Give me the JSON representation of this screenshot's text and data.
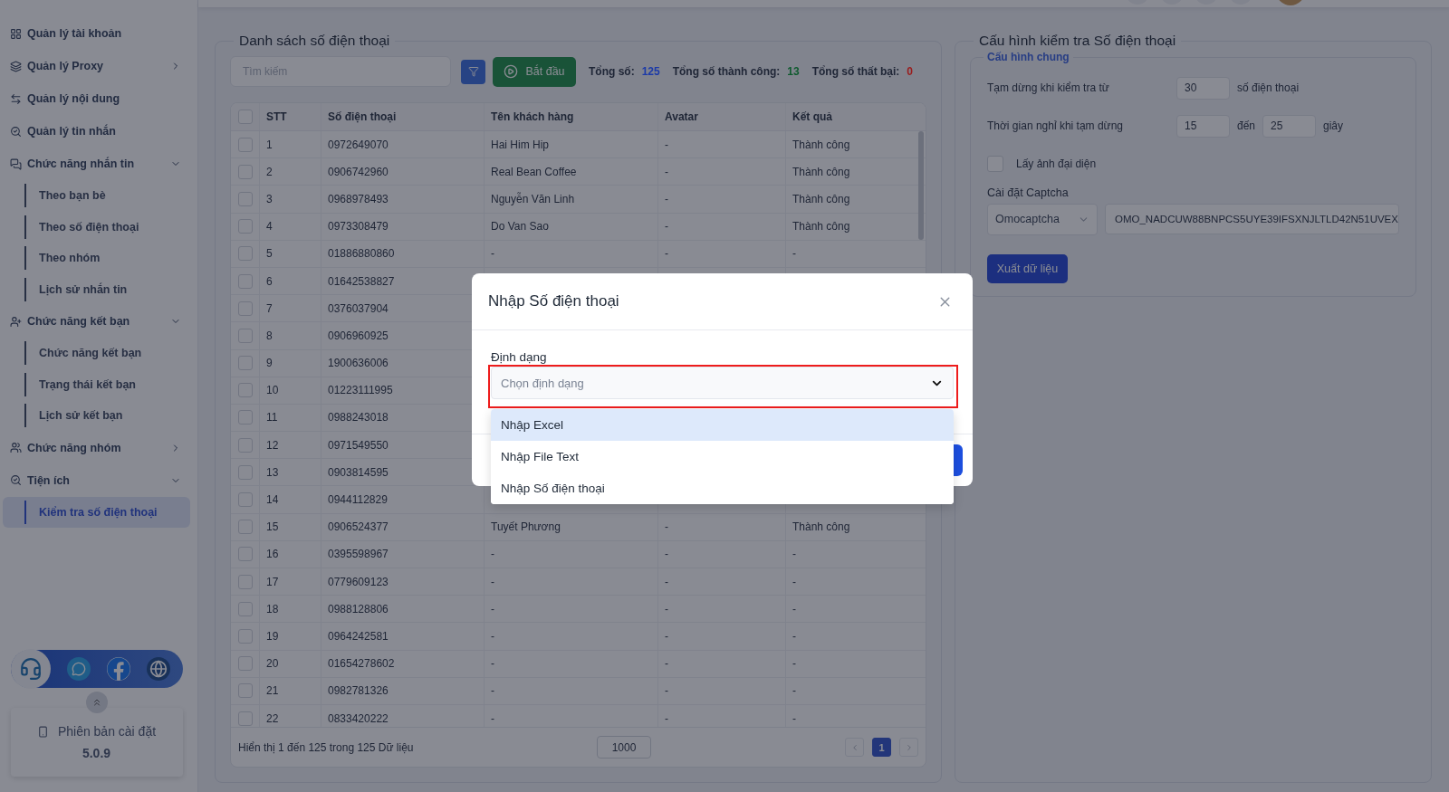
{
  "sidebar": {
    "items": [
      {
        "kind": "link",
        "label": "Quản lý tài khoản"
      },
      {
        "kind": "group",
        "label": "Quản lý Proxy",
        "expanded": false
      },
      {
        "kind": "link",
        "label": "Quản lý nội dung"
      },
      {
        "kind": "link",
        "label": "Quản lý tin nhắn"
      },
      {
        "kind": "group",
        "label": "Chức năng nhắn tin",
        "expanded": true,
        "children": [
          {
            "label": "Theo bạn bè",
            "selected": false
          },
          {
            "label": "Theo số điện thoại",
            "selected": false
          },
          {
            "label": "Theo nhóm",
            "selected": false
          },
          {
            "label": "Lịch sử nhắn tin",
            "selected": false
          }
        ]
      },
      {
        "kind": "group",
        "label": "Chức năng kết bạn",
        "expanded": true,
        "children": [
          {
            "label": "Chức năng kết bạn",
            "selected": false
          },
          {
            "label": "Trạng thái kết bạn",
            "selected": false
          },
          {
            "label": "Lịch sử kết bạn",
            "selected": false
          }
        ]
      },
      {
        "kind": "group",
        "label": "Chức năng nhóm",
        "expanded": false
      },
      {
        "kind": "group",
        "label": "Tiện ích",
        "expanded": true,
        "children": [
          {
            "label": "Kiểm tra số điện thoại",
            "selected": true
          }
        ]
      }
    ],
    "version": {
      "label": "Phiên bản cài đặt",
      "value": "5.0.9"
    }
  },
  "phone_list": {
    "title": "Danh sách số điện thoại",
    "search": {
      "placeholder": "Tìm kiếm"
    },
    "start_button": "Bắt đầu",
    "stats": [
      {
        "label": "Tổng số:",
        "value": "125",
        "color": "#1c3aa8"
      },
      {
        "label": "Tổng số thành công:",
        "value": "13",
        "color": "#0e5a2e"
      },
      {
        "label": "Tổng số thất bại:",
        "value": "0",
        "color": "#9a1c1c"
      }
    ],
    "table": {
      "header_checked": false,
      "columns": [
        "STT",
        "Số điện thoại",
        "Tên khách hàng",
        "Avatar",
        "Kết quả"
      ],
      "rows": [
        {
          "checked": false,
          "stt": "1",
          "phone": "0972649070",
          "customer": "Hai Him Hip",
          "avatar": "-",
          "result": "Thành công"
        },
        {
          "checked": false,
          "stt": "2",
          "phone": "0906742960",
          "customer": "Real Bean Coffee",
          "avatar": "-",
          "result": "Thành công"
        },
        {
          "checked": false,
          "stt": "3",
          "phone": "0968978493",
          "customer": "Nguyễn Văn Linh",
          "avatar": "-",
          "result": "Thành công"
        },
        {
          "checked": false,
          "stt": "4",
          "phone": "0973308479",
          "customer": "Do Van Sao",
          "avatar": "-",
          "result": "Thành công"
        },
        {
          "checked": false,
          "stt": "5",
          "phone": "01886880860",
          "customer": "-",
          "avatar": "-",
          "result": "-"
        },
        {
          "checked": false,
          "stt": "6",
          "phone": "01642538827"
        },
        {
          "checked": false,
          "stt": "7",
          "phone": "0376037904"
        },
        {
          "checked": false,
          "stt": "8",
          "phone": "0906960925"
        },
        {
          "checked": false,
          "stt": "9",
          "phone": "1900636006"
        },
        {
          "checked": false,
          "stt": "10",
          "phone": "01223111995"
        },
        {
          "checked": false,
          "stt": "11",
          "phone": "0988243018"
        },
        {
          "checked": false,
          "stt": "12",
          "phone": "0971549550"
        },
        {
          "checked": false,
          "stt": "13",
          "phone": "0903814595"
        },
        {
          "checked": false,
          "stt": "14",
          "phone": "0944112829"
        },
        {
          "checked": false,
          "stt": "15",
          "phone": "0906524377",
          "customer": "Tuyết Phương",
          "avatar": "-",
          "result": "Thành công"
        },
        {
          "checked": false,
          "stt": "16",
          "phone": "0395598967",
          "customer": "-",
          "avatar": "-",
          "result": "-"
        },
        {
          "checked": false,
          "stt": "17",
          "phone": "0779609123",
          "customer": "-",
          "avatar": "-",
          "result": "-"
        },
        {
          "checked": false,
          "stt": "18",
          "phone": "0988128806",
          "customer": "-",
          "avatar": "-",
          "result": "-"
        },
        {
          "checked": false,
          "stt": "19",
          "phone": "0964242581",
          "customer": "-",
          "avatar": "-",
          "result": "-"
        },
        {
          "checked": false,
          "stt": "20",
          "phone": "01654278602",
          "customer": "-",
          "avatar": "-",
          "result": "-"
        },
        {
          "checked": false,
          "stt": "21",
          "phone": "0982781326",
          "customer": "-",
          "avatar": "-",
          "result": "-"
        },
        {
          "checked": false,
          "stt": "22",
          "phone": "0833420222",
          "customer": "-",
          "avatar": "-",
          "result": "-"
        }
      ]
    },
    "footer": {
      "summary": "Hiển thị 1 đến 125 trong 125 Dữ liệu",
      "page_size": "1000",
      "pages": [
        {
          "label": "1",
          "selected": true
        }
      ]
    }
  },
  "config": {
    "title": "Cấu hình kiểm tra Số điện thoại",
    "section_title": "Cấu hình chung",
    "pause_label": "Tạm dừng khi kiểm tra từ",
    "pause_value": "30",
    "pause_unit": "số điện thoại",
    "rest_label": "Thời gian nghỉ khi tạm dừng",
    "rest_from": "15",
    "rest_between": "đến",
    "rest_to": "25",
    "rest_unit": "giây",
    "avatar_checkbox": {
      "label": "Lấy ảnh đại diện",
      "checked": false
    },
    "captcha_label": "Cài đặt Captcha",
    "captcha_provider": "Omocaptcha",
    "captcha_key": "OMO_NADCUW88BNPCS5UYE39IFSXNJLTLD42N51UVEX",
    "export_button": "Xuất dữ liệu"
  },
  "modal": {
    "title": "Nhập Số điện thoại",
    "field_label": "Định dạng",
    "select": {
      "placeholder": "Chọn định dạng",
      "highlight": true
    },
    "options": [
      {
        "label": "Nhập Excel",
        "selected": true
      },
      {
        "label": "Nhập File Text",
        "selected": false
      },
      {
        "label": "Nhập Số điện thoại",
        "selected": false
      }
    ]
  }
}
